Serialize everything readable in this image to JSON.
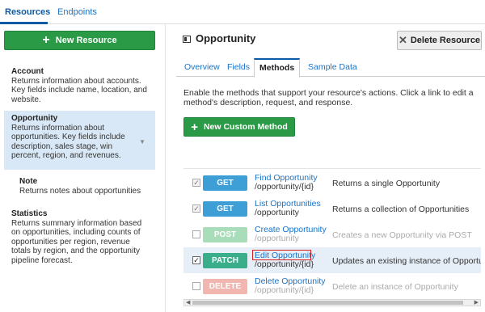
{
  "top_tabs": [
    "Resources",
    "Endpoints"
  ],
  "left": {
    "new_resource_label": "New Resource",
    "resources": [
      {
        "name": "Account",
        "desc": "Returns information about accounts. Key fields include name, location, and website."
      },
      {
        "name": "Opportunity",
        "desc": "Returns information about opportunities. Key fields include description, sales stage, win percent, region, and revenues."
      },
      {
        "name": "Note",
        "desc": "Returns notes about opportunities"
      },
      {
        "name": "Statistics",
        "desc": "Returns summary information based on opportunities, including counts of opportunities per region, revenue totals by region, and the opportunity pipeline forecast."
      }
    ]
  },
  "main": {
    "title": "Opportunity",
    "delete_label": "Delete Resource",
    "tabs": [
      "Overview",
      "Fields",
      "Methods",
      "Sample Data"
    ],
    "description": "Enable the methods that support your resource's actions. Click a link to edit a method's description, request, and response.",
    "new_method_label": "New Custom Method",
    "methods": [
      {
        "verb": "GET",
        "name": "Find Opportunity",
        "path": "/opportunity/{id}",
        "desc": "Returns a single Opportunity"
      },
      {
        "verb": "GET",
        "name": "List Opportunities",
        "path": "/opportunity",
        "desc": "Returns a collection of Opportunities"
      },
      {
        "verb": "POST",
        "name": "Create Opportunity",
        "path": "/opportunity",
        "desc": "Creates a new Opportunity via POST"
      },
      {
        "verb": "PATCH",
        "name": "Edit Opportunity",
        "path": "/opportunity/{id}",
        "desc": "Updates an existing instance of Opportunity"
      },
      {
        "verb": "DELETE",
        "name": "Delete Opportunity",
        "path": "/opportunity/{id}",
        "desc": "Delete an instance of Opportunity"
      }
    ]
  },
  "colors": {
    "green": "#2b9a46",
    "link": "#1a73c8",
    "get": "#3e9fd6",
    "patch": "#3aae8a",
    "highlight": "#d62020"
  }
}
